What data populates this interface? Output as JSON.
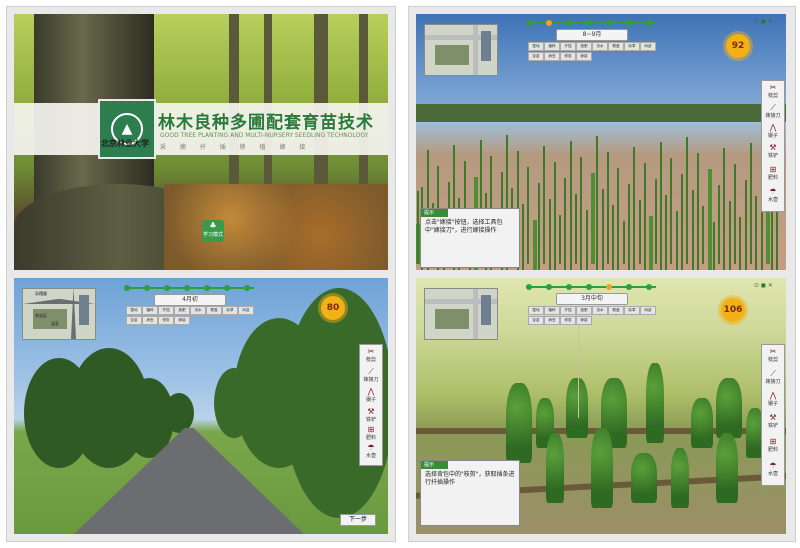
{
  "title_screen": {
    "title": "林木良种多圃配套育苗技术",
    "subtitle": "GOOD TREE PLANTING AND MULTI-NURSERY SEEDLING TECHNOLOGY",
    "tags": "采 摘 扦 插 移 植 嫁 接",
    "university": "北京林业大学",
    "enter_label": "学习模式"
  },
  "toolbar_labels": [
    "整地",
    "播种",
    "扦插",
    "施肥",
    "浇水",
    "覆盖",
    "除草",
    "间苗",
    "定苗",
    "病虫",
    "修剪",
    "嫁接"
  ],
  "tools": [
    {
      "label": "枝剪",
      "icon": "pruning-shears-icon"
    },
    {
      "label": "嫁接刀",
      "icon": "grafting-knife-icon"
    },
    {
      "label": "镊子",
      "icon": "tweezers-icon"
    },
    {
      "label": "铁铲",
      "icon": "shovel-icon"
    },
    {
      "label": "肥料",
      "icon": "fertilizer-icon"
    },
    {
      "label": "水壶",
      "icon": "watering-can-icon"
    }
  ],
  "road_scene": {
    "date": "4月初",
    "score": "80",
    "next_label": "下一步",
    "map_labels": [
      "育苗区",
      "温室",
      "采穗圃"
    ]
  },
  "seedling_scene": {
    "date": "8~9月",
    "score": "92",
    "tip_header": "提示",
    "tip_text": "点击\"嫁接\"按钮，选择工具包中\"嫁接刀\"，进行嫁接操作"
  },
  "vine_scene": {
    "date": "3月中旬",
    "score": "106",
    "tip_header": "提示",
    "tip_text": "选择背包中的\"枝剪\"，获取插条进行扦插操作"
  },
  "colors": {
    "accent_green": "#2f9e3f",
    "timeline_active": "#f1a21b",
    "title_green": "#2a7a3c"
  }
}
